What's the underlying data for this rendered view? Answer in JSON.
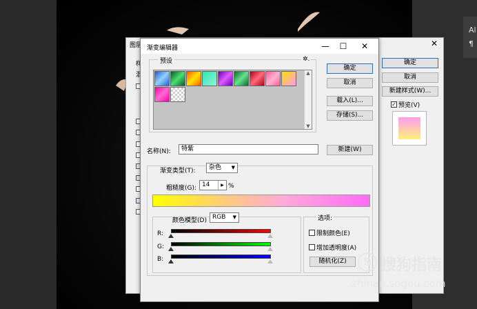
{
  "layer_style": {
    "title": "图层",
    "close": "✕",
    "ok": "确定",
    "cancel": "取消",
    "new_style": "新建样式(W)...",
    "preview_label": "预览(V)",
    "preview_checked": "✓",
    "side_fragment_1": "样",
    "side_fragment_2": "混"
  },
  "gradient_editor": {
    "title": "渐变编辑器",
    "window_controls": {
      "minimize": "—",
      "maximize": "☐",
      "close": "✕"
    },
    "presets_label": "预设",
    "presets_gear": "✲.",
    "buttons": {
      "ok": "确定",
      "cancel": "取消",
      "load": "载入(L)...",
      "save": "存储(S)...",
      "new": "新建(W)"
    },
    "name_label": "名称(N):",
    "name_value": "特紫",
    "gradient_type_label": "渐变类型(T):",
    "gradient_type_value": "杂色",
    "roughness_label": "粗糙度(G):",
    "roughness_value": "14",
    "roughness_unit": "%",
    "color_model_label": "颜色模型(D)",
    "color_model_value": "RGB",
    "channels": {
      "r": "R:",
      "g": "G:",
      "b": "B:"
    },
    "options_label": "选项:",
    "restrict_colors": "限制颜色(E)",
    "add_transparency": "增加透明度(A)",
    "randomize": "随机化(Z)"
  },
  "side_strip": {
    "a": "Al",
    "b": "¶"
  },
  "watermark": {
    "logo": "S",
    "text": "搜狗指南",
    "url": "zhinan.sogou.com"
  }
}
